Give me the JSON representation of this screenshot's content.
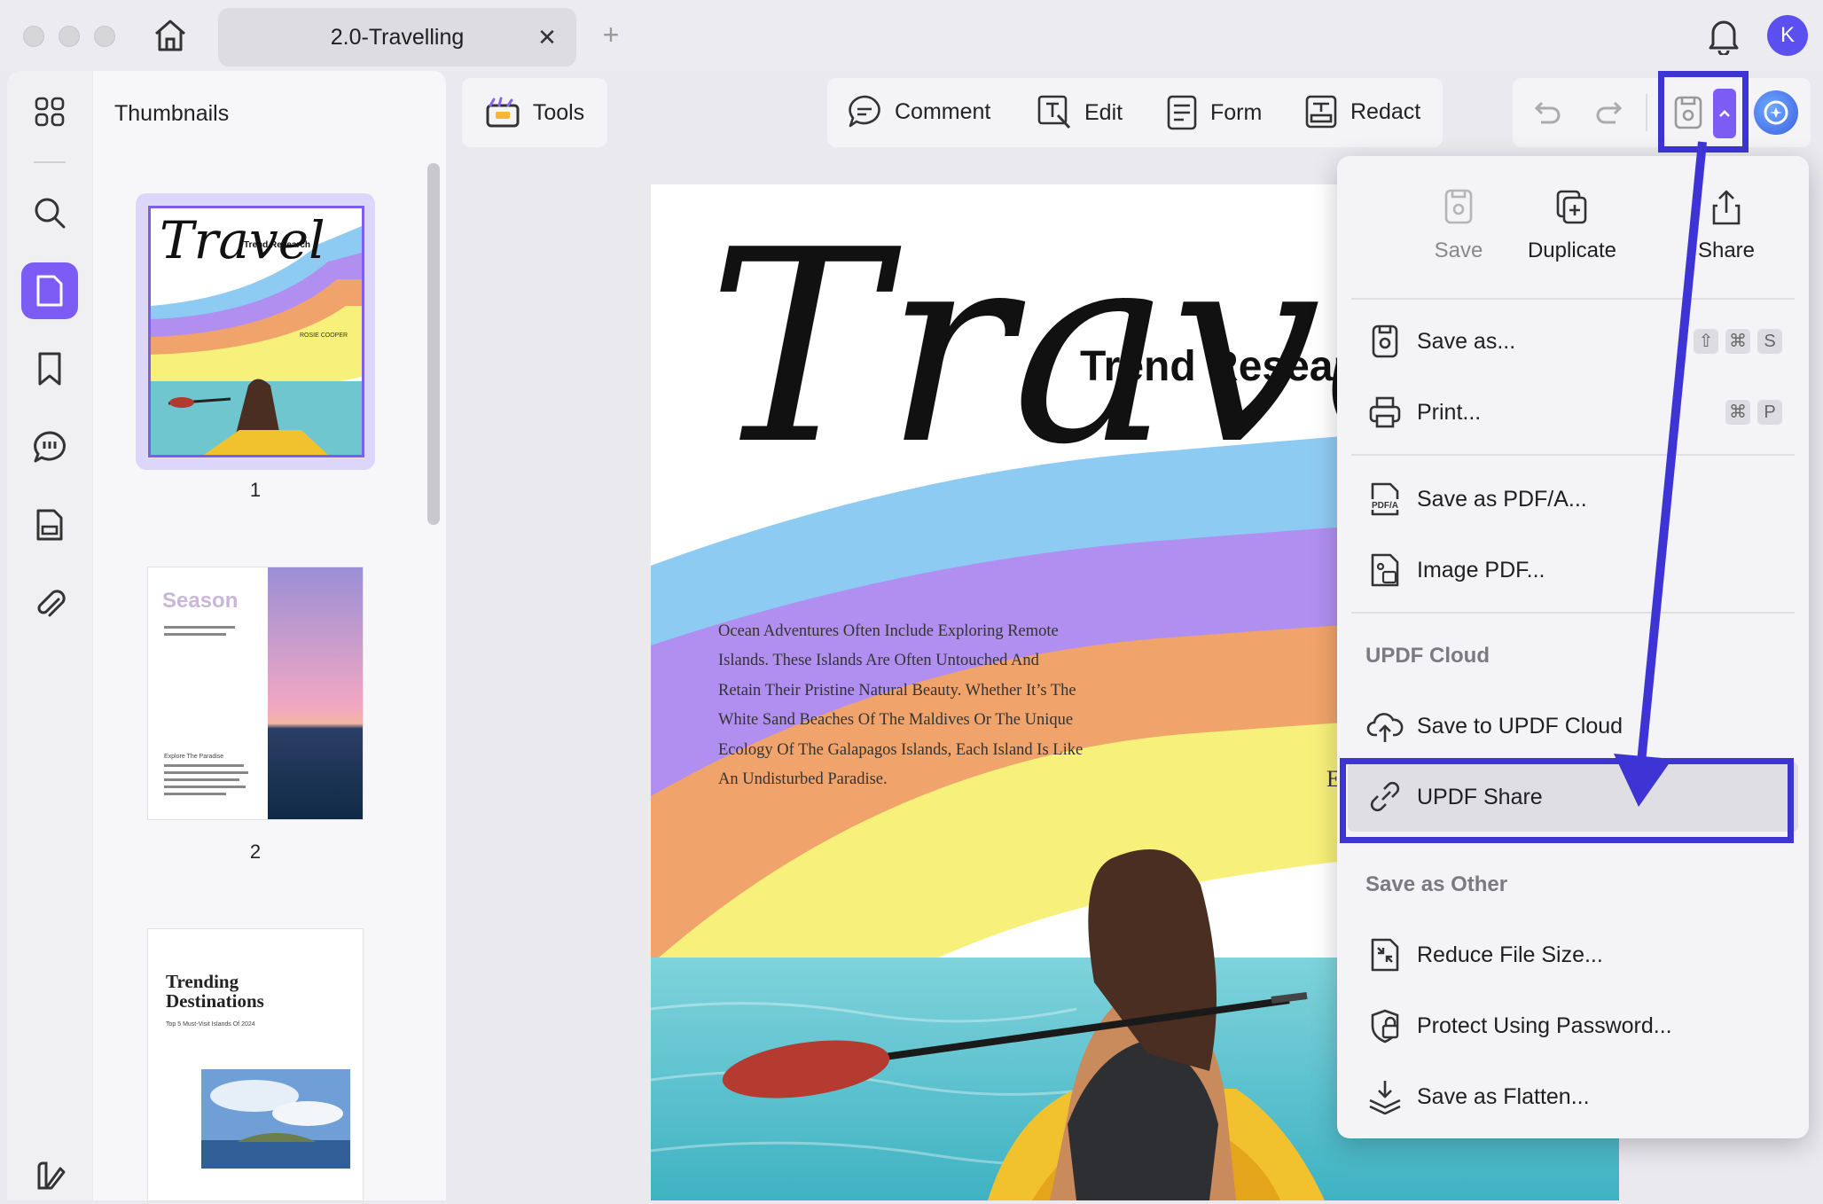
{
  "window": {
    "tab_title": "2.0-Travelling",
    "avatar_initial": "K"
  },
  "thumbnails": {
    "title": "Thumbnails",
    "pages": [
      "1",
      "2"
    ],
    "thumb1_title": "Travel",
    "thumb1_subtitle": "Trend Research",
    "thumb1_author": "ROSIE COOPER",
    "thumb2_title": "Season",
    "thumb2_heading": "Explore The Paradise",
    "thumb3_title_line1": "Trending",
    "thumb3_title_line2": "Destinations",
    "thumb3_subtitle": "Top 5 Must-Visit Islands Of 2024"
  },
  "toolbar": {
    "tools_label": "Tools",
    "comment_label": "Comment",
    "edit_label": "Edit",
    "form_label": "Form",
    "redact_label": "Redact"
  },
  "document": {
    "script_title": "Travel",
    "subtitle": "Trend Resear",
    "body_lines": [
      "Ocean Adventures Often Include Exploring Remote",
      "Islands. These Islands Are Often Untouched And",
      "Retain Their Pristine Natural Beauty. Whether It’s The",
      "White Sand Beaches Of The Maldives Or The Unique",
      "Ecology Of The Galapagos Islands, Each Island Is Like",
      "An Undisturbed Paradise."
    ],
    "edge_letter": "E"
  },
  "menu": {
    "top_actions": {
      "save": "Save",
      "duplicate": "Duplicate",
      "share": "Share"
    },
    "save_as": "Save as...",
    "save_as_shortcut": [
      "⇧",
      "⌘",
      "S"
    ],
    "print": "Print...",
    "print_shortcut": [
      "⌘",
      "P"
    ],
    "save_pdfa": "Save as PDF/A...",
    "image_pdf": "Image PDF...",
    "cloud_section": "UPDF Cloud",
    "save_cloud": "Save to UPDF Cloud",
    "updf_share": "UPDF Share",
    "other_section": "Save as Other",
    "reduce": "Reduce File Size...",
    "protect": "Protect Using Password...",
    "flatten": "Save as Flatten..."
  },
  "colors": {
    "accent": "#7d5cf5",
    "highlight_box": "#3e34d6",
    "rainbow": [
      "#8ecbf3",
      "#b08ff0",
      "#f0a36a",
      "#f7f07a"
    ]
  }
}
